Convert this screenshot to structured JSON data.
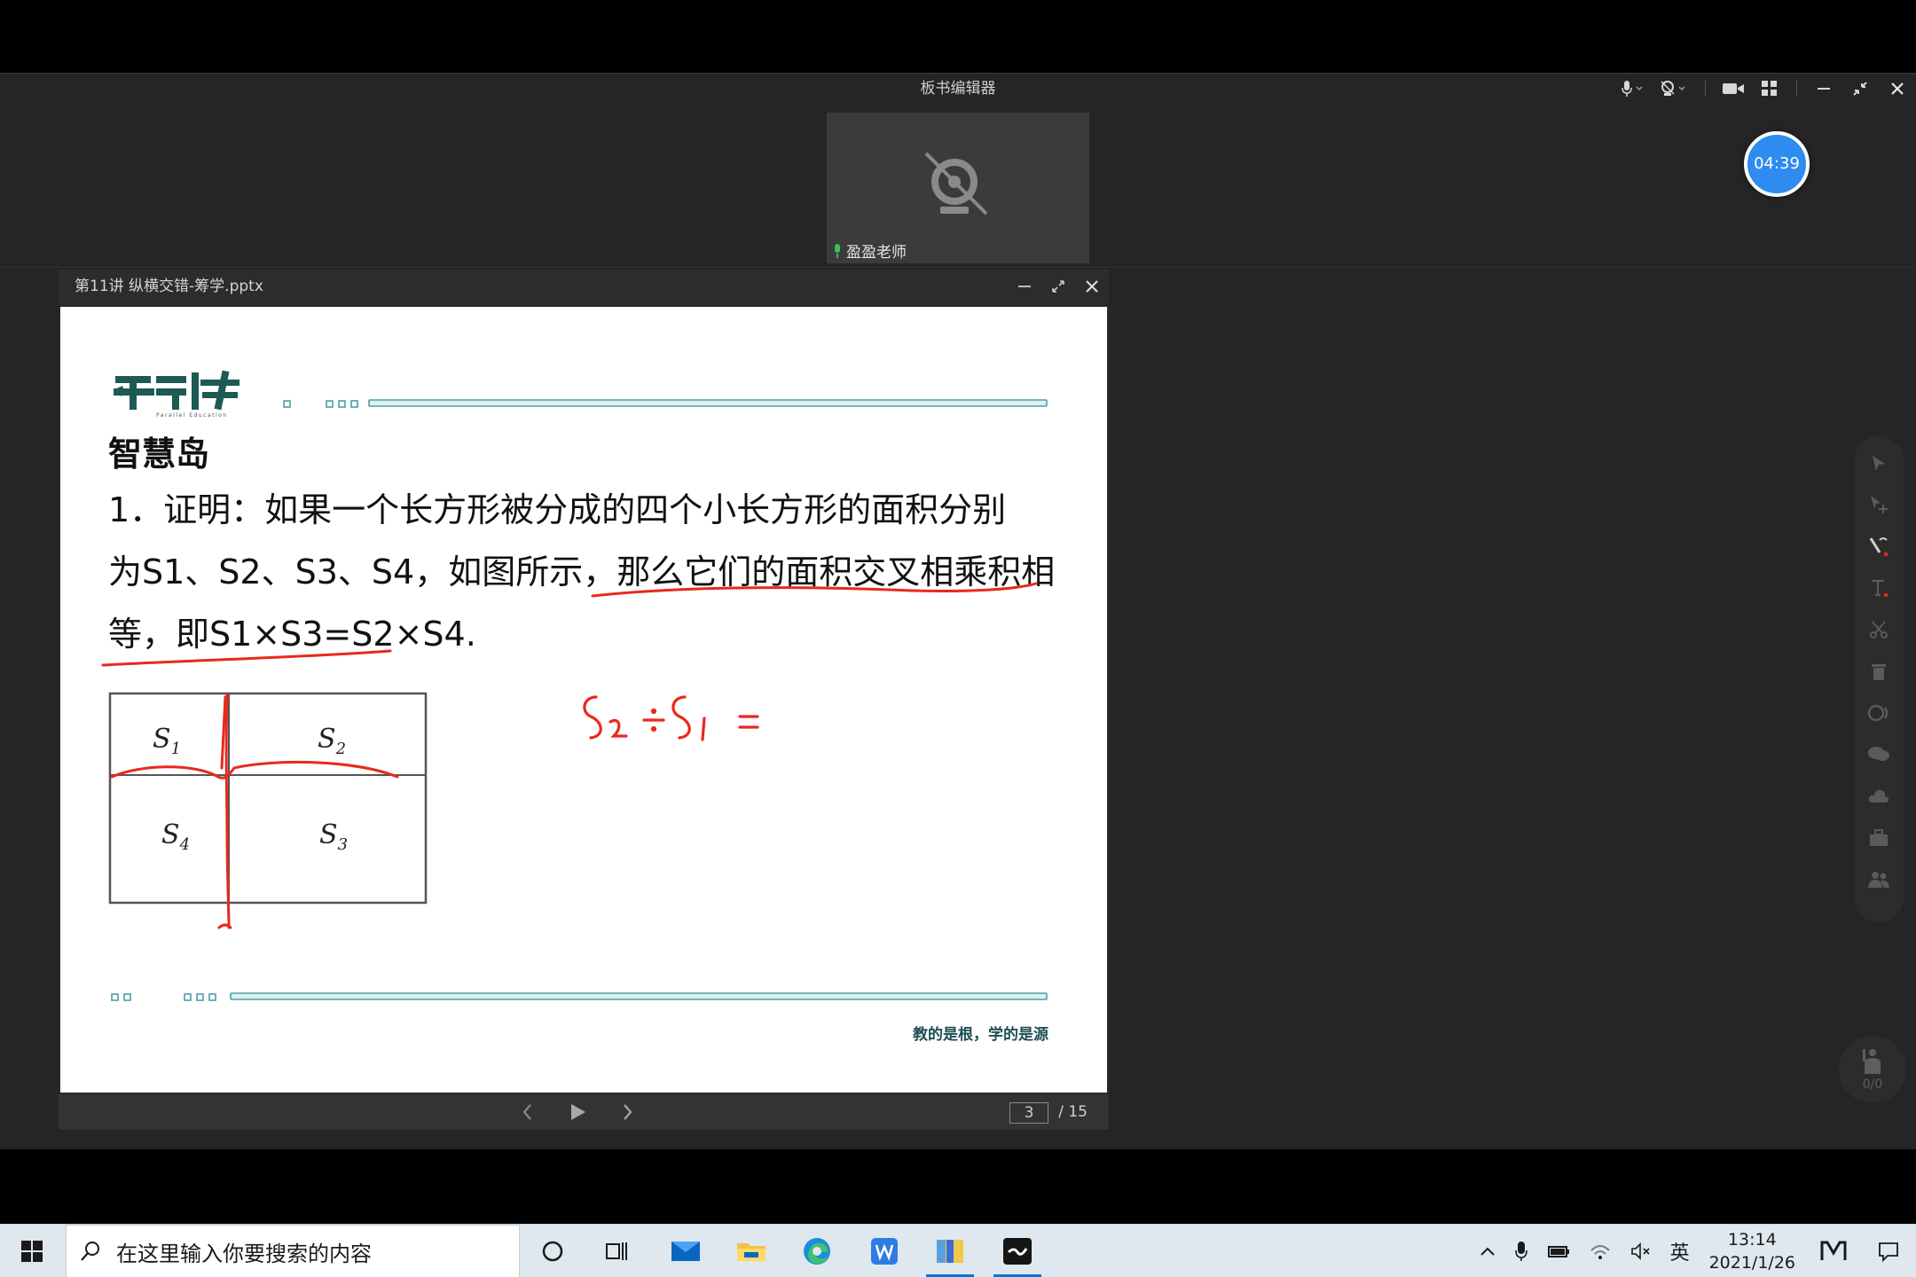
{
  "app": {
    "title": "板书编辑器",
    "teacher_name": "盈盈老师",
    "timer": "04:39"
  },
  "document": {
    "title": "第11讲 纵横交错-筹学.pptx",
    "page_current": "3",
    "page_total": "/ 15"
  },
  "slide": {
    "heading": "智慧岛",
    "lines": [
      "1．证明：如果一个长方形被分成的四个小长方形的面积分别",
      "为S1、S2、S3、S4，如图所示，那么它们的面积交叉相乘积相",
      "等，即S1×S3=S2×S4."
    ],
    "diagram_labels": {
      "s1": "S",
      "s1_sub": "1",
      "s2": "S",
      "s2_sub": "2",
      "s3": "S",
      "s3_sub": "3",
      "s4": "S",
      "s4_sub": "4"
    },
    "handwriting": "S2÷S1=",
    "motto": "教的是根，学的是源"
  },
  "toolbar": {
    "hand_count": "0/0"
  },
  "taskbar": {
    "search_placeholder": "在这里输入你要搜索的内容",
    "ime": "英",
    "time": "13:14",
    "date": "2021/1/26"
  },
  "colors": {
    "accent": "#2e8cf0",
    "ink": "#e8291c",
    "slide_teal": "#5aa7a7"
  }
}
